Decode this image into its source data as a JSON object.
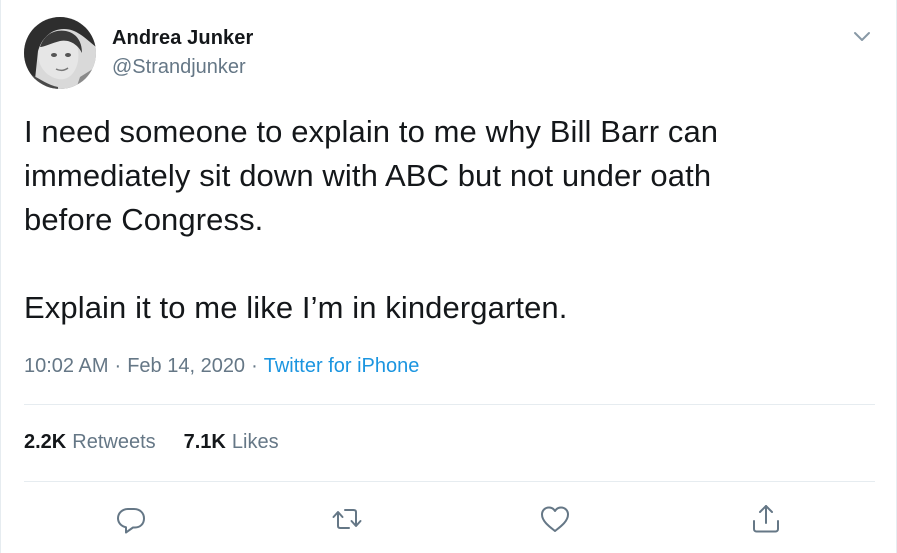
{
  "author": {
    "name": "Andrea Junker",
    "handle": "@Strandjunker",
    "avatar_icon": "profile-photo"
  },
  "tweet": {
    "text": "I need someone to explain to me why Bill Barr can\nimmediately sit down with ABC but not under oath\nbefore Congress.\n\nExplain it to me like I’m in kindergarten.",
    "time": "10:02 AM",
    "separator": "·",
    "date": "Feb 14, 2020",
    "source": "Twitter for iPhone"
  },
  "stats": {
    "retweets_count": "2.2K",
    "retweets_label": "Retweets",
    "likes_count": "7.1K",
    "likes_label": "Likes"
  },
  "actions": {
    "reply_icon": "reply-icon",
    "retweet_icon": "retweet-icon",
    "like_icon": "heart-icon",
    "share_icon": "share-icon",
    "menu_icon": "chevron-down-icon"
  },
  "colors": {
    "text": "#14171a",
    "secondary": "#657786",
    "link": "#1b95e0",
    "divider": "#e6ecf0"
  }
}
